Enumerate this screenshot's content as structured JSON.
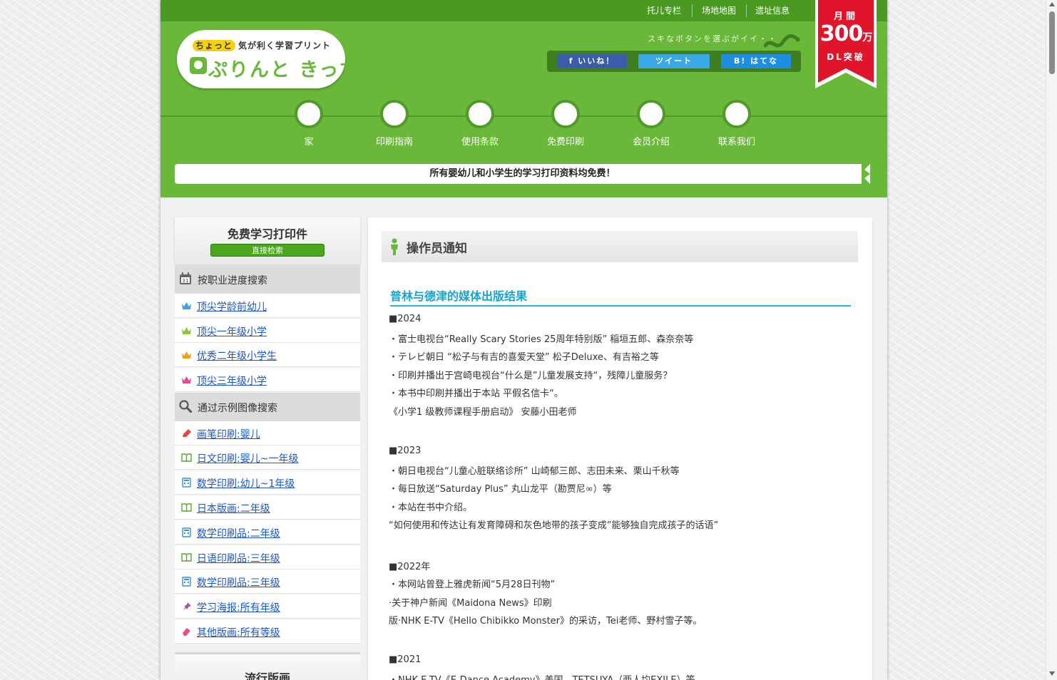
{
  "topbar": {
    "links": [
      "托儿专栏",
      "场地地图",
      "遗址信息"
    ]
  },
  "logo": {
    "tag": "ちょっと",
    "small_text": "気が利く学習プリント",
    "big_text": "ぷりんと きっず"
  },
  "share": {
    "caption": "スキなボタンを選ぶがイイ・・",
    "facebook": "f いいね！",
    "twitter": "ツイート",
    "hatena": "B! はてな"
  },
  "badge": {
    "line1": "月間",
    "line2": "300",
    "unit": "万",
    "line3": "DL突破"
  },
  "nav": [
    "家",
    "印刷指南",
    "使用条款",
    "免费印刷",
    "会员介绍",
    "联系我们"
  ],
  "notice": "所有婴幼儿和小学生的学习打印资料均免费！",
  "sidebar": {
    "title": "免费学习打印件",
    "direct_search": "直接检索",
    "sections": [
      {
        "label": "按职业进度搜索",
        "items": [
          "顶尖学龄前幼儿",
          "顶尖一年级小学",
          "优秀二年级小学生",
          "顶尖三年级小学"
        ]
      },
      {
        "label": "通过示例图像搜索",
        "items": [
          "画笔印刷:婴儿",
          "日文印刷:婴儿~一年级",
          "数学印刷:幼儿~1年级",
          "日本版画:二年级",
          "数学印刷品:二年级",
          "日语印刷品:三年级",
          "数学印刷品:三年级",
          "学习海报:所有年级",
          "其他版画:所有等级"
        ]
      }
    ],
    "popular": "流行版画"
  },
  "main": {
    "heading": "操作员通知",
    "article_title": "普林与德津的媒体出版结果",
    "lines": [
      "■2024",
      "・富士电视台“Really Scary Stories 25周年特别版” 稲垣五郎、森奈奈等",
      "・テレビ朝日 “松子与有吉的喜爱天堂” 松子Deluxe、有吉裕之等",
      "・印刷并播出于宫崎电视台“什么是”儿童发展支持“，残障儿童服务？",
      "・本书中印刷并播出于本站 平假名信卡“。",
      "《小学1 级教师课程手册启动》 安藤小田老师",
      "■2023",
      "・朝日电视台“儿童心脏联络诊所” 山崎郁三郎、志田未来、栗山千秋等",
      "・每日放送“Saturday Plus” 丸山龙平（勘贾尼∞）等",
      "・本站在书中介绍。",
      "“如何使用和传达让有发育障碍和灰色地带的孩子变成”能够独自完成孩子的话语”",
      "■2022年",
      "・本网站曾登上雅虎新闻“5月28日刊物”",
      "·关于神户新闻《Maidona News》印刷",
      "版·NHK E-TV《Hello Chibikko Monster》的采访，Tei老师、野村雪子等。",
      "■2021",
      "・NHK E-TV《E-Dance Academy》美国，TETSUYA（两人均EXILE）等"
    ]
  },
  "colors": {
    "header_green": "#6ab83a",
    "topbar_green": "#4a9a22",
    "badge_red": "#e0142a",
    "link_blue": "#1a55cc",
    "title_blue": "#1aa3cf"
  }
}
